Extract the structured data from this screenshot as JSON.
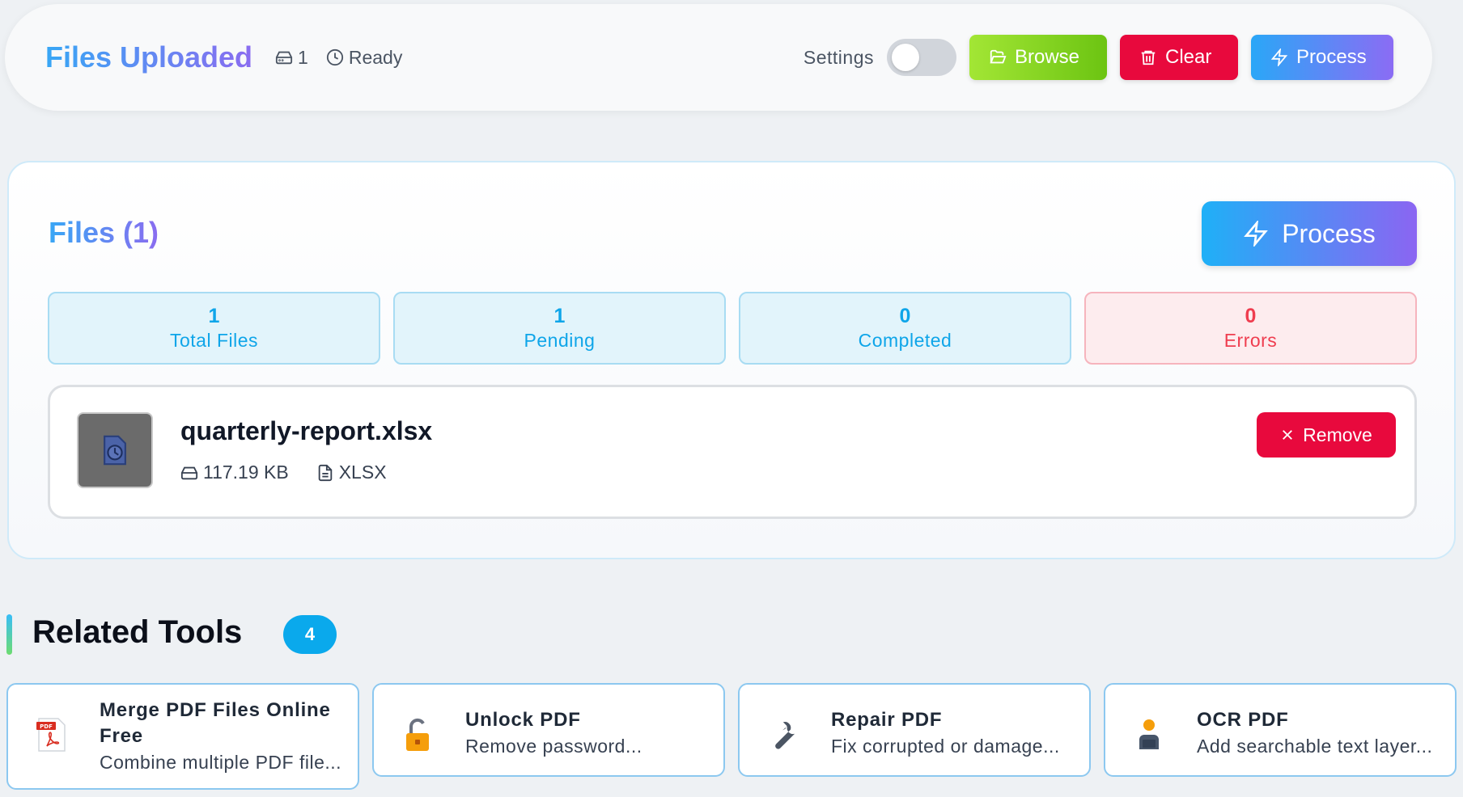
{
  "header": {
    "title": "Files Uploaded",
    "file_count": "1",
    "status": "Ready",
    "settings_label": "Settings",
    "settings_on": false,
    "browse_label": "Browse",
    "clear_label": "Clear",
    "process_label": "Process"
  },
  "files_panel": {
    "title": "Files (1)",
    "process_label": "Process",
    "stats": [
      {
        "value": "1",
        "label": "Total Files"
      },
      {
        "value": "1",
        "label": "Pending"
      },
      {
        "value": "0",
        "label": "Completed"
      },
      {
        "value": "0",
        "label": "Errors"
      }
    ],
    "file": {
      "name": "quarterly-report.xlsx",
      "size": "117.19 KB",
      "type": "XLSX",
      "remove_label": "Remove"
    }
  },
  "related_tools": {
    "title": "Related Tools",
    "count": "4",
    "items": [
      {
        "name": "Merge PDF Files Online Free",
        "desc": "Combine multiple PDF file...",
        "icon": "pdf-file-icon"
      },
      {
        "name": "Unlock PDF",
        "desc": "Remove password...",
        "icon": "unlock-icon"
      },
      {
        "name": "Repair PDF",
        "desc": "Fix corrupted or damage...",
        "icon": "wrench-icon"
      },
      {
        "name": "OCR PDF",
        "desc": "Add searchable text layer...",
        "icon": "ocr-person-icon"
      }
    ]
  },
  "colors": {
    "accent_gradient_start": "#38a7f5",
    "accent_gradient_end": "#8a6cf0",
    "browse": "#84cc16",
    "danger": "#e8093d",
    "stat_info": "#0ea5e9",
    "stat_error": "#ef3d4f"
  }
}
